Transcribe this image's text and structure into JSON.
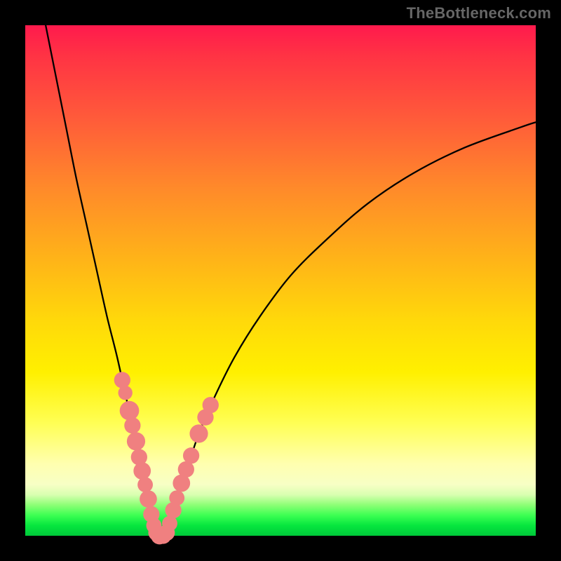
{
  "watermark": "TheBottleneck.com",
  "chart_data": {
    "type": "line",
    "title": "",
    "xlabel": "",
    "ylabel": "",
    "xlim": [
      0,
      100
    ],
    "ylim": [
      0,
      100
    ],
    "series": [
      {
        "name": "left-branch",
        "x": [
          4,
          6,
          8,
          10,
          12,
          14,
          16,
          18,
          20,
          21,
          22,
          23,
          24,
          25,
          25.8
        ],
        "y": [
          100,
          90,
          80,
          70,
          61,
          52,
          43,
          35,
          26,
          22,
          18,
          13,
          9,
          4,
          0
        ]
      },
      {
        "name": "right-branch",
        "x": [
          27.5,
          28.5,
          30,
          32,
          34,
          37,
          41,
          46,
          52,
          59,
          67,
          76,
          86,
          97,
          100
        ],
        "y": [
          0,
          3,
          8,
          14,
          20,
          27,
          35,
          43,
          51,
          58,
          65,
          71,
          76,
          80,
          81
        ]
      }
    ],
    "flat_segment": {
      "x": [
        25.8,
        27.5
      ],
      "y": 0
    },
    "scatter": {
      "name": "highlight-dots",
      "color": "#f08080",
      "points": [
        {
          "x": 19.0,
          "y": 30.5,
          "r": 1.6
        },
        {
          "x": 19.6,
          "y": 28.0,
          "r": 1.4
        },
        {
          "x": 20.4,
          "y": 24.5,
          "r": 1.9
        },
        {
          "x": 21.0,
          "y": 21.6,
          "r": 1.6
        },
        {
          "x": 21.7,
          "y": 18.5,
          "r": 1.8
        },
        {
          "x": 22.3,
          "y": 15.4,
          "r": 1.6
        },
        {
          "x": 22.9,
          "y": 12.7,
          "r": 1.7
        },
        {
          "x": 23.5,
          "y": 10.0,
          "r": 1.5
        },
        {
          "x": 24.1,
          "y": 7.2,
          "r": 1.7
        },
        {
          "x": 24.7,
          "y": 4.2,
          "r": 1.6
        },
        {
          "x": 25.2,
          "y": 2.0,
          "r": 1.5
        },
        {
          "x": 25.7,
          "y": 0.6,
          "r": 1.6
        },
        {
          "x": 26.3,
          "y": 0.0,
          "r": 1.7
        },
        {
          "x": 27.0,
          "y": 0.0,
          "r": 1.6
        },
        {
          "x": 27.7,
          "y": 0.6,
          "r": 1.6
        },
        {
          "x": 28.3,
          "y": 2.4,
          "r": 1.5
        },
        {
          "x": 29.0,
          "y": 5.0,
          "r": 1.6
        },
        {
          "x": 29.7,
          "y": 7.4,
          "r": 1.5
        },
        {
          "x": 30.6,
          "y": 10.3,
          "r": 1.7
        },
        {
          "x": 31.5,
          "y": 13.0,
          "r": 1.6
        },
        {
          "x": 32.5,
          "y": 15.7,
          "r": 1.6
        },
        {
          "x": 34.0,
          "y": 20.0,
          "r": 1.8
        },
        {
          "x": 35.3,
          "y": 23.2,
          "r": 1.6
        },
        {
          "x": 36.3,
          "y": 25.6,
          "r": 1.6
        }
      ]
    },
    "gradient_stops": [
      {
        "pos": 0,
        "color": "#ff1a4d"
      },
      {
        "pos": 18,
        "color": "#ff5a3a"
      },
      {
        "pos": 45,
        "color": "#ffb119"
      },
      {
        "pos": 68,
        "color": "#fff000"
      },
      {
        "pos": 86,
        "color": "#ffffb0"
      },
      {
        "pos": 94,
        "color": "#8cff75"
      },
      {
        "pos": 100,
        "color": "#00c93a"
      }
    ]
  }
}
